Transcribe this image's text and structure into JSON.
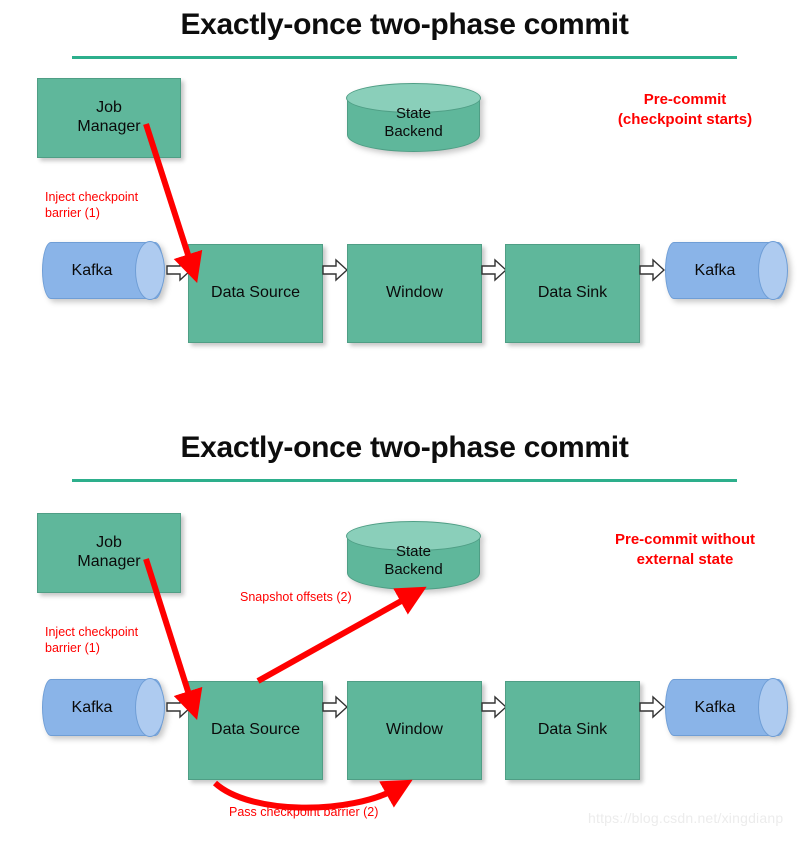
{
  "watermark": "https://blog.csdn.net/xingdianp",
  "theme": {
    "box_green": "#5FB79B",
    "cylinder_blue": "#8AB4E8",
    "cylinder_blue_cap": "#AECBF0",
    "cylinder_green_top": "#8ACFBA",
    "title_rule": "#2DAF8C",
    "annotation_red": "#FF0000",
    "text_black": "#0A0A0A"
  },
  "panels": [
    {
      "title": "Exactly-once two-phase commit",
      "phase_heading": "Pre-commit\n(checkpoint starts)",
      "phase_heading_lines": [
        "Pre-commit",
        "(checkpoint starts)"
      ],
      "job_manager": "Job\nManager",
      "job_manager_lines": [
        "Job",
        "Manager"
      ],
      "state_backend_lines": [
        "State",
        "Backend"
      ],
      "source_kafka": "Kafka",
      "sink_kafka": "Kafka",
      "pipeline": [
        "Data Source",
        "Window",
        "Data Sink"
      ],
      "annotations": [
        {
          "id": "inject-barrier",
          "lines": [
            "Inject checkpoint",
            "barrier (1)"
          ]
        }
      ]
    },
    {
      "title": "Exactly-once two-phase commit",
      "phase_heading_lines": [
        "Pre-commit without",
        "external state"
      ],
      "job_manager_lines": [
        "Job",
        "Manager"
      ],
      "state_backend_lines": [
        "State",
        "Backend"
      ],
      "source_kafka": "Kafka",
      "sink_kafka": "Kafka",
      "pipeline": [
        "Data Source",
        "Window",
        "Data Sink"
      ],
      "annotations": [
        {
          "id": "inject-barrier",
          "lines": [
            "Inject checkpoint",
            "barrier (1)"
          ]
        },
        {
          "id": "snapshot-offsets",
          "text": "Snapshot offsets (2)"
        },
        {
          "id": "pass-barrier",
          "text": "Pass checkpoint barrier (2)"
        }
      ]
    }
  ]
}
